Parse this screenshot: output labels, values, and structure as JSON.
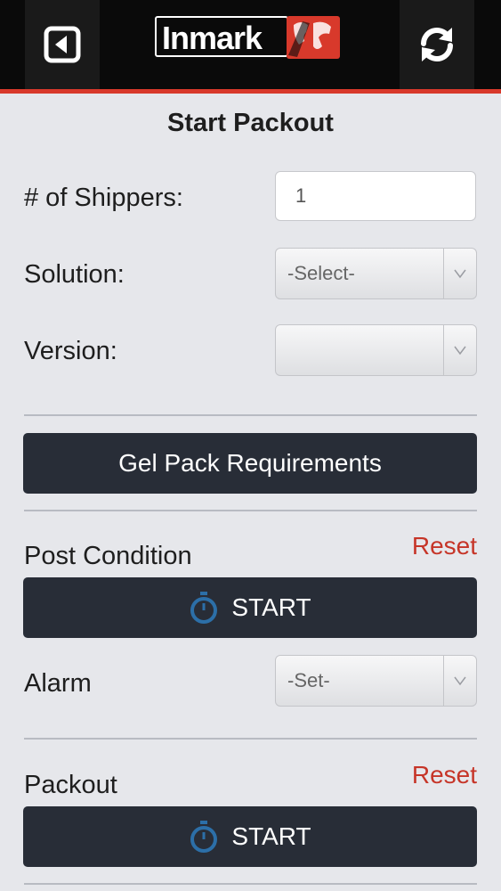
{
  "header": {
    "logo_text": "Inmark",
    "back_icon": "back-arrow-icon",
    "refresh_icon": "refresh-icon",
    "accent_color": "#d8392b"
  },
  "page": {
    "title": "Start Packout"
  },
  "form": {
    "shippers_label": "# of Shippers:",
    "shippers_value": "1",
    "solution_label": "Solution:",
    "solution_value": "-Select-",
    "version_label": "Version:",
    "version_value": ""
  },
  "gel_pack_button": "Gel Pack Requirements",
  "post_condition": {
    "title": "Post Condition",
    "reset_label": "Reset",
    "start_label": "START",
    "alarm_label": "Alarm",
    "alarm_value": "-Set-"
  },
  "packout": {
    "title": "Packout",
    "reset_label": "Reset",
    "start_label": "START"
  },
  "colors": {
    "button_bg": "#282d37",
    "reset": "#c63528",
    "stopwatch": "#2c6fa8"
  }
}
